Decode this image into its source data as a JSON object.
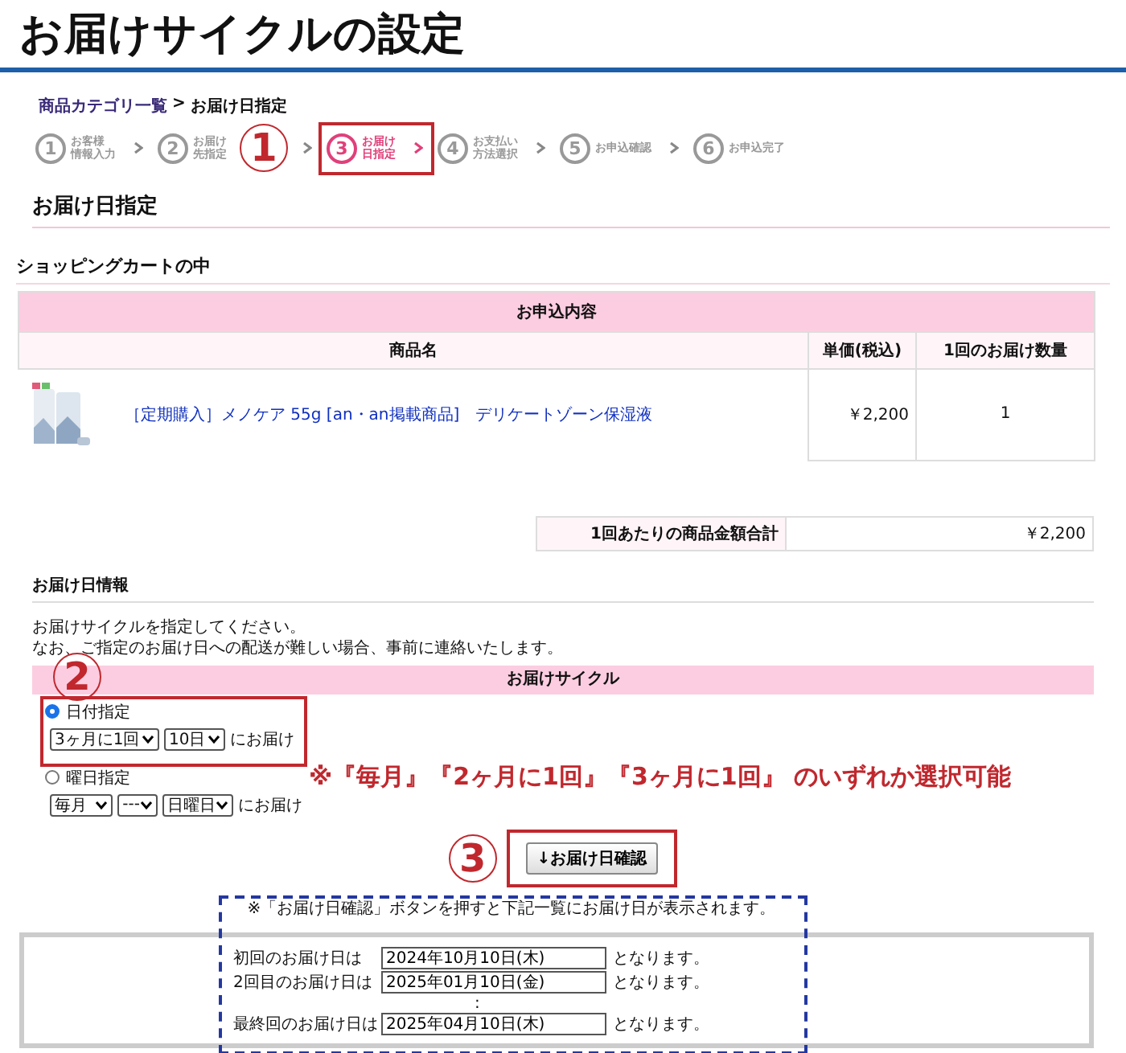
{
  "page_title": "お届けサイクルの設定",
  "breadcrumb": {
    "link": "商品カテゴリ一覧",
    "separator": ">",
    "current": "お届け日指定"
  },
  "steps": [
    {
      "number": "1",
      "lines": [
        "お客様",
        "情報入力"
      ],
      "selected": false
    },
    {
      "number": "2",
      "lines": [
        "お届け",
        "先指定"
      ],
      "selected": false
    },
    {
      "number": "3",
      "lines": [
        "お届け",
        "日指定"
      ],
      "selected": true
    },
    {
      "number": "4",
      "lines": [
        "お支払い",
        "方法選択"
      ],
      "selected": false
    },
    {
      "number": "5",
      "lines": [
        "お申込確認"
      ],
      "selected": false
    },
    {
      "number": "6",
      "lines": [
        "お申込完了"
      ],
      "selected": false
    }
  ],
  "callouts": [
    "1",
    "2",
    "3"
  ],
  "section_title": "お届け日指定",
  "cart": {
    "title": "ショッピングカートの中",
    "caption": "お申込内容",
    "columns": [
      "商品名",
      "単価(税込)",
      "1回のお届け数量"
    ],
    "rows": [
      {
        "kind": "picture",
        "product": "［定期購入］メノケア 55g [an・an掲載商品]　デリケートゾーン保湿液",
        "price": "￥2,200",
        "quantity": "1"
      }
    ]
  },
  "total": {
    "label": "1回あたりの商品金額合計",
    "value": "￥2,200"
  },
  "delivery": {
    "title": "お届け日情報",
    "description": [
      "お届けサイクルを指定してください。",
      "なお、ご指定のお届け日への配送が難しい場合、事前に連絡いたします。"
    ]
  },
  "cycle": {
    "header": "お届けサイクル",
    "options": [
      {
        "label": "日付指定",
        "selected": true,
        "selects": [
          "3ヶ月に1回",
          "10日"
        ],
        "suffix": "にお届け"
      },
      {
        "label": "曜日指定",
        "selected": false,
        "selects": [
          "毎月",
          "---",
          "日曜日"
        ],
        "suffix": "にお届け"
      }
    ],
    "note": "※『毎月』『2ヶ月に1回』『3ヶ月に1回』 のいずれか選択可能"
  },
  "confirm_button": "↓お届け日確認",
  "schedule": {
    "note": "※「お届け日確認」ボタンを押すと下記一覧にお届け日が表示されます。",
    "rows": [
      {
        "kind": "date",
        "label": "初回のお届け日は",
        "date": "2024年10月10日(木)",
        "suffix": "となります。"
      },
      {
        "kind": "date",
        "label": "2回目のお届け日は",
        "date": "2025年01月10日(金)",
        "suffix": "となります。"
      },
      {
        "kind": "gap",
        "label": ":"
      },
      {
        "kind": "date",
        "label": "最終回のお届け日は",
        "date": "2025年04月10日(木)",
        "suffix": "となります。"
      }
    ]
  }
}
